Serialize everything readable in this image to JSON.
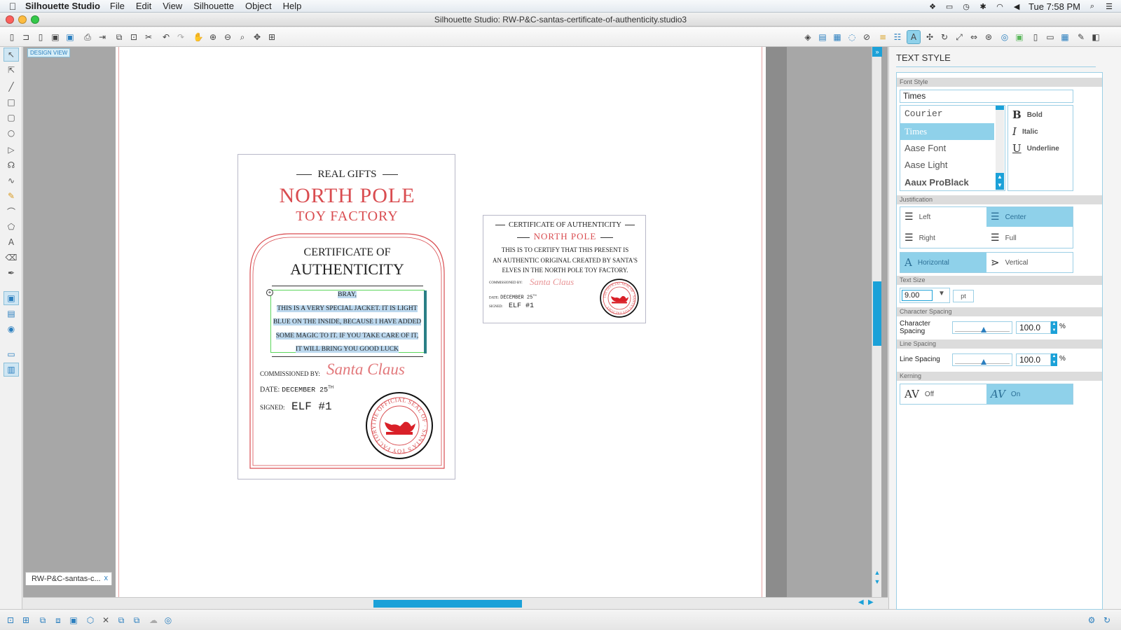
{
  "menubar": {
    "app_name": "Silhouette Studio",
    "items": [
      "File",
      "Edit",
      "View",
      "Silhouette",
      "Object",
      "Help"
    ],
    "clock": "Tue 7:58 PM"
  },
  "window": {
    "title": "Silhouette Studio: RW-P&C-santas-certificate-of-authenticity.studio3"
  },
  "canvas": {
    "design_view_label": "DESIGN VIEW",
    "doc_tab_label": "RW-P&C-santas-c...",
    "doc_tab_close": "x"
  },
  "certificate_large": {
    "top_line": "REAL GIFTS",
    "title_line1": "NORTH POLE",
    "title_line2": "TOY FACTORY",
    "cert_line1": "CERTIFICATE OF",
    "cert_line2": "AUTHENTICITY",
    "name_line": "BRAY,",
    "message_lines": [
      "THIS IS A VERY SPECIAL JACKET. IT IS LIGHT",
      "BLUE ON THE INSIDE, BECAUSE I HAVE ADDED",
      "SOME MAGIC TO IT. IF YOU TAKE CARE OF IT,",
      "IT WILL BRING YOU GOOD LUCK"
    ],
    "commissioned_label": "COMMISSIONED BY:",
    "signature": "Santa Claus",
    "date_label": "DATE:",
    "date_value": "DECEMBER 25",
    "date_sup": "TH",
    "signed_label": "SIGNED:",
    "signed_value": "ELF #1",
    "seal_text": "THE OFFICIAL SEAL OF · SANTA'S TOY FACTORY ·"
  },
  "certificate_small": {
    "top_line": "CERTIFICATE OF AUTHENTICITY",
    "title": "NORTH POLE",
    "body_lines": [
      "THIS IS TO CERTIFY THAT THIS PRESENT IS",
      "AN AUTHENTIC ORIGINAL CREATED BY SANTA'S",
      "ELVES IN THE NORTH POLE TOY FACTORY."
    ],
    "commissioned_label": "COMMISSIONED BY:",
    "signature": "Santa Claus",
    "date_label": "DATE:",
    "date_value": "DECEMBER 25",
    "date_sup": "TH",
    "signed_label": "SIGNED:",
    "signed_value": "ELF #1",
    "seal_text": "THE OFFICIAL SEAL OF · SANTA'S TOY FACTORY ·"
  },
  "panel": {
    "title": "TEXT STYLE",
    "font_style_header": "Font Style",
    "font_value": "Times",
    "fonts": [
      {
        "name": "Courier",
        "selected": false
      },
      {
        "name": "Times",
        "selected": true
      },
      {
        "name": "Aase Font",
        "selected": false
      },
      {
        "name": "Aase Light",
        "selected": false
      },
      {
        "name": "Aaux ProBlack",
        "selected": false
      }
    ],
    "style_buttons": [
      {
        "glyph": "B",
        "label": "Bold"
      },
      {
        "glyph": "I",
        "label": "Italic"
      },
      {
        "glyph": "U",
        "label": "Underline"
      }
    ],
    "justification_header": "Justification",
    "justify": {
      "left": "Left",
      "center": "Center",
      "right": "Right",
      "full": "Full"
    },
    "orientation": {
      "horizontal": "Horizontal",
      "vertical": "Vertical"
    },
    "text_size_header": "Text Size",
    "text_size_value": "9.00",
    "text_size_unit": "pt",
    "char_spacing_header": "Character Spacing",
    "char_spacing_label": "Character Spacing",
    "char_spacing_value": "100.0",
    "line_spacing_header": "Line Spacing",
    "line_spacing_label": "Line Spacing",
    "line_spacing_value": "100.0",
    "percent": "%",
    "kerning_header": "Kerning",
    "kerning": {
      "off": "Off",
      "on": "On",
      "glyph": "AV"
    }
  },
  "colors": {
    "accent": "#1ba1d8",
    "selected_fill": "#8fd1ea",
    "cert_red": "#d94c50"
  }
}
